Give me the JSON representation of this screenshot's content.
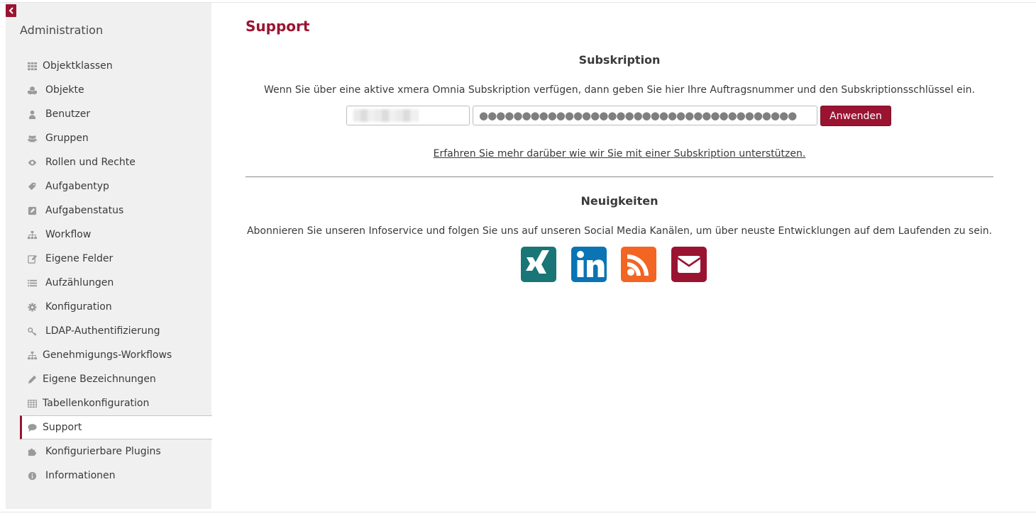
{
  "sidebar": {
    "title": "Administration",
    "items": [
      {
        "label": "Objektklassen",
        "icon": "grid-icon"
      },
      {
        "label": "Objekte",
        "icon": "cubes-icon"
      },
      {
        "label": "Benutzer",
        "icon": "user-icon"
      },
      {
        "label": "Gruppen",
        "icon": "users-icon"
      },
      {
        "label": "Rollen und Rechte",
        "icon": "eye-icon"
      },
      {
        "label": "Aufgabentyp",
        "icon": "tags-icon"
      },
      {
        "label": "Aufgabenstatus",
        "icon": "edit-square-icon"
      },
      {
        "label": "Workflow",
        "icon": "sitemap-icon"
      },
      {
        "label": "Eigene Felder",
        "icon": "pencil-square-icon"
      },
      {
        "label": "Aufzählungen",
        "icon": "list-icon"
      },
      {
        "label": "Konfiguration",
        "icon": "gear-icon"
      },
      {
        "label": "LDAP-Authentifizierung",
        "icon": "key-icon"
      },
      {
        "label": "Genehmigungs-Workflows",
        "icon": "sitemap-icon"
      },
      {
        "label": "Eigene Bezeichnungen",
        "icon": "pencil-icon"
      },
      {
        "label": "Tabellenkonfiguration",
        "icon": "table-icon"
      },
      {
        "label": "Support",
        "icon": "comment-icon",
        "active": true
      },
      {
        "label": "Konfigurierbare Plugins",
        "icon": "puzzle-icon"
      },
      {
        "label": "Informationen",
        "icon": "info-icon"
      }
    ]
  },
  "main": {
    "title": "Support",
    "subscription": {
      "heading": "Subskription",
      "description": "Wenn Sie über eine aktive xmera Omnia Subskription verfügen, dann geben Sie hier Ihre Auftragsnummer und den Subskriptionsschlüssel ein.",
      "key_value": "●●●●●●●●●●●●●●●●●●●●●●●●●●●●●●●●●●●●●",
      "apply_label": "Anwenden",
      "learn_more": "Erfahren Sie mehr darüber wie wir Sie mit einer Subskription unterstützen."
    },
    "news": {
      "heading": "Neuigkeiten",
      "description": "Abonnieren Sie unseren Infoservice und folgen Sie uns auf unseren Social Media Kanälen, um über neuste Entwicklungen auf dem Laufenden zu sein.",
      "channels": [
        {
          "icon": "xing-icon",
          "color": "#1a7576"
        },
        {
          "icon": "linkedin-icon",
          "color": "#0a74b4"
        },
        {
          "icon": "rss-icon",
          "color": "#f26522"
        },
        {
          "icon": "envelope-icon",
          "color": "#9a1432"
        }
      ]
    }
  },
  "colors": {
    "accent": "#9a1432",
    "sidebar_bg": "#f0f0f0"
  }
}
